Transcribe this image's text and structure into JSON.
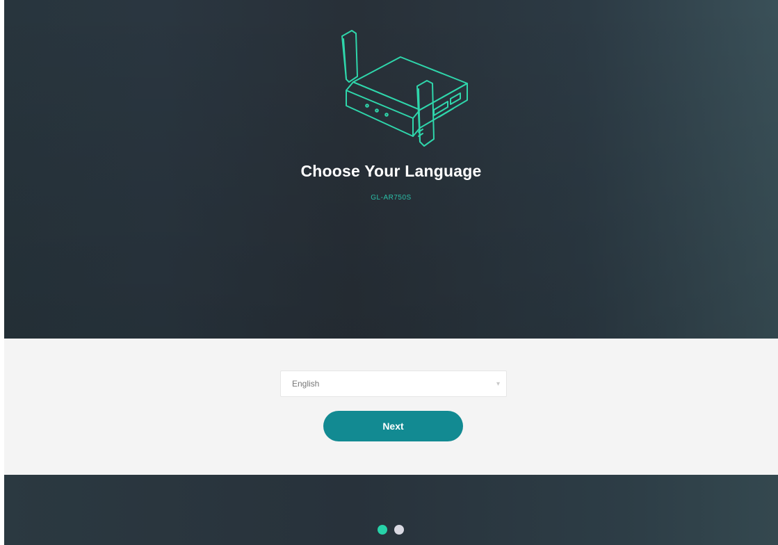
{
  "hero": {
    "title": "Choose Your Language",
    "model": "GL-AR750S"
  },
  "language_select": {
    "value": "English",
    "caret": "▾"
  },
  "actions": {
    "next_label": "Next"
  },
  "pagination": {
    "total": 2,
    "current": 1
  },
  "colors": {
    "accent": "#128a92",
    "device_outline": "#2fd6ab",
    "active_dot": "#27d2a8",
    "inactive_dot": "#d9d9e2"
  }
}
